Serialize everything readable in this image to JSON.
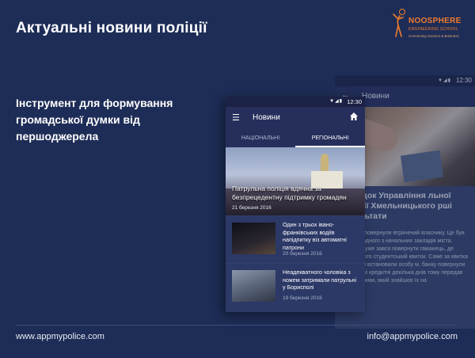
{
  "slide": {
    "title": "Актуальні новини поліції",
    "subtitle": "Інструмент для формування громадської думки від першоджерела"
  },
  "logo": {
    "name": "NOOSPHERE",
    "sub": "ENGINEERING SCHOOL",
    "tagline": "Connecting Science & Business",
    "color": "#f07c2c"
  },
  "footer": {
    "website": "www.appmypolice.com",
    "email": "info@appmypolice.com"
  },
  "phone_back": {
    "time": "12:30",
    "toolbar_title": "Новини",
    "headline": "знахідок Управління льної поліції Хмельницького рші результати",
    "body": "атрульні повернули втрачений власнику. Це був студент одного з начальних закладів міста. Хлопець уже зався повернути гаманець, де окрім у його студентський квиток. Саме за квитка патрульні встановили особу м. банку повернули 2 втрачені кредитні декілька днів тому передав патрульними, який знайшов їх на"
  },
  "phone_front": {
    "time": "12:30",
    "toolbar_title": "Новини",
    "tabs": [
      {
        "label": "НАЦІОНАЛЬНІ",
        "active": false
      },
      {
        "label": "РЕГІОНАЛЬНІ",
        "active": true
      }
    ],
    "hero": {
      "headline": "Патрульна поліція вдячна за безпрецедентну підтримку громадян",
      "date": "21 березня 2016"
    },
    "items": [
      {
        "headline": "Один з трьох івано-франківських водіїв напідпитку віз автоматні патрони",
        "date": "20 березня 2016"
      },
      {
        "headline": "Неадекватного чоловіка з ножем затримали патрульні у Борисполі",
        "date": "19 березня 2016"
      }
    ]
  },
  "colors": {
    "background": "#1e2d57",
    "phone_toolbar": "#262f5c",
    "accent": "#f07c2c"
  }
}
